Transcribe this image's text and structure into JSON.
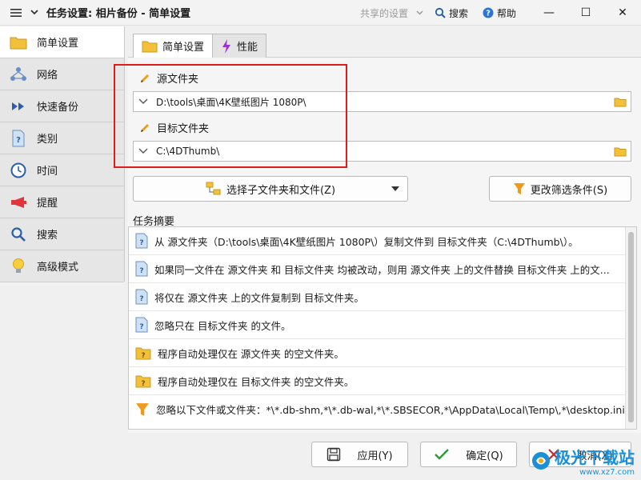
{
  "window": {
    "title": "任务设置: 相片备份 - 简单设置",
    "shared_settings": "共享的设置",
    "search": "搜索",
    "help": "帮助",
    "minimize": "—",
    "maximize": "☐",
    "close": "✕"
  },
  "nav": {
    "items": [
      {
        "label": "简单设置"
      },
      {
        "label": "网络"
      },
      {
        "label": "快速备份"
      },
      {
        "label": "类别"
      },
      {
        "label": "时间"
      },
      {
        "label": "提醒"
      },
      {
        "label": "搜索"
      },
      {
        "label": "高级模式"
      }
    ]
  },
  "tabs": [
    {
      "label": "简单设置"
    },
    {
      "label": "性能"
    }
  ],
  "source": {
    "label": "源文件夹",
    "path": "D:\\tools\\桌面\\4K壁纸图片 1080P\\"
  },
  "target": {
    "label": "目标文件夹",
    "path": "C:\\4DThumb\\"
  },
  "buttons": {
    "select_subfolders": "选择子文件夹和文件(Z)",
    "change_filter": "更改筛选条件(S)",
    "apply": "应用(Y)",
    "ok": "确定(Q)",
    "cancel": "取消(X)"
  },
  "summary": {
    "label": "任务摘要",
    "rows": [
      {
        "icon": "doc",
        "text": "从 源文件夹（D:\\tools\\桌面\\4K壁纸图片 1080P\\）复制文件到 目标文件夹（C:\\4DThumb\\）。"
      },
      {
        "icon": "doc",
        "text": "如果同一文件在 源文件夹 和 目标文件夹 均被改动，则用 源文件夹 上的文件替换 目标文件夹 上的文..."
      },
      {
        "icon": "doc",
        "text": "将仅在 源文件夹 上的文件复制到 目标文件夹。"
      },
      {
        "icon": "doc",
        "text": "忽略只在 目标文件夹 的文件。"
      },
      {
        "icon": "folder",
        "text": "程序自动处理仅在 源文件夹 的空文件夹。"
      },
      {
        "icon": "folder",
        "text": "程序自动处理仅在 目标文件夹 的空文件夹。"
      },
      {
        "icon": "filter",
        "text": "忽略以下文件或文件夹：*\\*.db-shm,*\\*.db-wal,*\\*.SBSECOR,*\\AppData\\Local\\Temp\\,*\\desktop.ini,*\\DfsrP..."
      }
    ]
  },
  "watermark": {
    "brand": "极光下载站",
    "url": "www.xz7.com"
  }
}
